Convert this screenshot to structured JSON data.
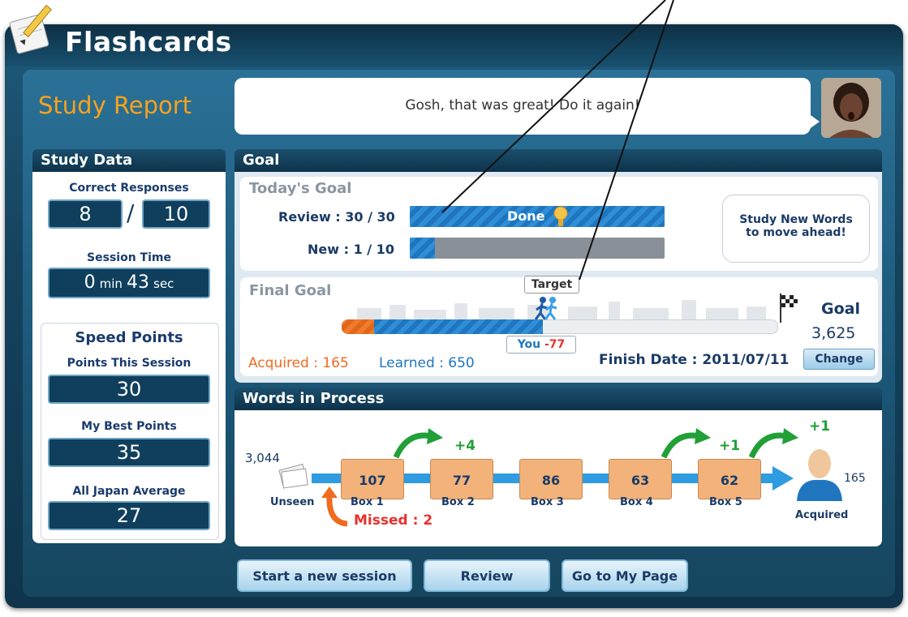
{
  "app": {
    "title": "Flashcards"
  },
  "report_title": "Study Report",
  "speech": "Gosh, that was great! Do it again!",
  "study_data": {
    "heading": "Study Data",
    "correct_label": "Correct Responses",
    "correct": "8",
    "separator": "/",
    "total": "10",
    "session_time_label": "Session Time",
    "session_min": "0",
    "min_unit": "min",
    "session_sec": "43",
    "sec_unit": "sec",
    "speed_heading": "Speed Points",
    "points_session_label": "Points This Session",
    "points_session": "30",
    "best_label": "My Best Points",
    "best": "35",
    "avg_label": "All Japan Average",
    "avg": "27"
  },
  "goal": {
    "heading": "Goal",
    "today_title": "Today's Goal",
    "review_label": "Review : 30 / 30",
    "review_progress": 1.0,
    "done_label": "Done",
    "new_label": "New : 1 / 10",
    "new_progress": 0.1,
    "tip": "Study New Words to move ahead!",
    "final_title": "Final Goal",
    "target_label": "Target",
    "you_label": "You",
    "you_delta": "-77",
    "goal_label": "Goal",
    "goal_value": "3,625",
    "acquired_label": "Acquired : 165",
    "learned_label": "Learned : 650",
    "finish_label": "Finish Date : 2011/07/11",
    "change_button": "Change"
  },
  "process": {
    "heading": "Words in Process",
    "unseen_count": "3,044",
    "unseen_label": "Unseen",
    "missed_label": "Missed : 2",
    "boxes": [
      {
        "label": "Box 1",
        "count": "107"
      },
      {
        "label": "Box 2",
        "count": "77"
      },
      {
        "label": "Box 3",
        "count": "86"
      },
      {
        "label": "Box 4",
        "count": "63"
      },
      {
        "label": "Box 5",
        "count": "62"
      }
    ],
    "gain_box2": "+4",
    "gain_box5": "+1",
    "gain_acquired": "+1",
    "acquired_count": "165",
    "acquired_label": "Acquired"
  },
  "buttons": {
    "start": "Start a new session",
    "review": "Review",
    "mypage": "Go to My Page"
  },
  "colors": {
    "accent_orange": "#f7a21d",
    "bar_blue": "#2f8ed6",
    "missed_red": "#e8312b",
    "gain_green": "#21a038"
  }
}
